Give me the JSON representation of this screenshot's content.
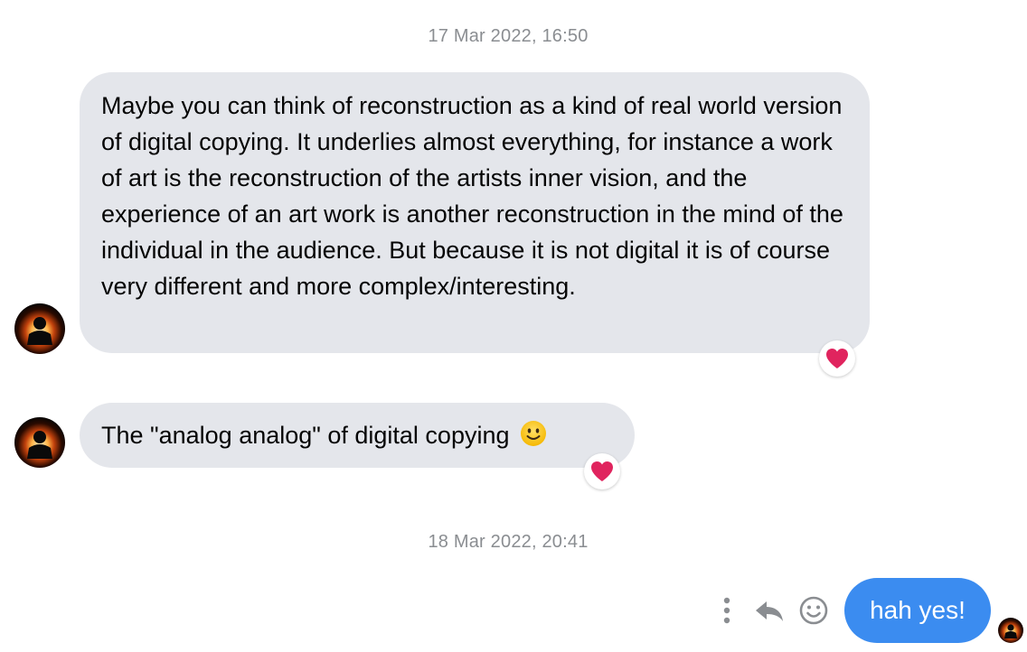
{
  "conversation": {
    "groups": [
      {
        "timestamp": "17 Mar 2022, 16:50",
        "messages": [
          {
            "text": "Maybe you can think of reconstruction as a kind of real world version of digital copying. It underlies almost everything, for instance a work of art is the reconstruction of the artists inner vision, and the experience of an art work is another reconstruction in the mind of the individual in the audience. But because it is not digital it is of course very different and more complex/interesting.",
            "direction": "incoming",
            "reaction": "red-heart-icon"
          },
          {
            "text": "The \"analog analog\" of digital copying",
            "emoji": "slightly-smiling-face-icon",
            "direction": "incoming",
            "reaction": "red-heart-icon"
          }
        ]
      },
      {
        "timestamp": "18 Mar 2022, 20:41",
        "messages": [
          {
            "text": "hah yes!",
            "direction": "outgoing",
            "read_receipt": "avatar-small"
          }
        ]
      }
    ]
  },
  "message_actions": [
    "more-icon",
    "reply-icon",
    "react-icon"
  ],
  "colors": {
    "incoming_bubble": "#e4e6eb",
    "outgoing_bubble": "#3b8cf0",
    "timestamp": "#8a8d91",
    "heart": "#e0245e",
    "action_icon": "#8a8d91"
  }
}
